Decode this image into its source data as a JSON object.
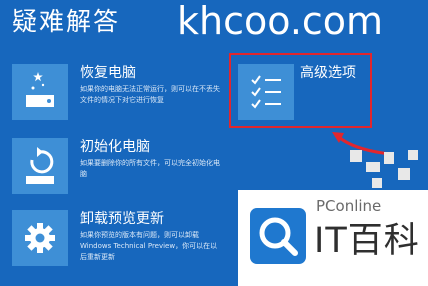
{
  "page": {
    "title": "疑难解答"
  },
  "watermark": {
    "text": "khcoo.com"
  },
  "options": [
    {
      "title": "恢复电脑",
      "desc": "如果你的电脑无法正常运行，则可以在不丢失文件的情况下对它进行恢复",
      "icon": "restore-icon"
    },
    {
      "title": "初始化电脑",
      "desc": "如果要删除你的所有文件，可以完全初始化电脑",
      "icon": "reset-icon"
    },
    {
      "title": "卸载预览更新",
      "desc": "如果你预览的版本有问题，则可以卸载 Windows Technical Preview，你可以在以后重新更新",
      "icon": "gear-icon"
    },
    {
      "title": "高级选项",
      "icon": "checklist-icon"
    }
  ],
  "logo": {
    "brand": "PConline",
    "name": "IT百科"
  },
  "colors": {
    "background": "#1767bd",
    "tile": "#3e8fd6",
    "highlight": "#e2262d"
  }
}
